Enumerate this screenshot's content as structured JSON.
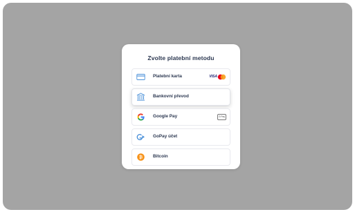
{
  "modal": {
    "title": "Zvolte platební metodu",
    "methods": [
      {
        "id": "card",
        "label": "Platební karta",
        "icon": "credit-card-icon",
        "badge_text": "VISA"
      },
      {
        "id": "bank",
        "label": "Bankovní převod",
        "icon": "bank-icon",
        "selected": true
      },
      {
        "id": "googlepay",
        "label": "Google Pay",
        "icon": "google-icon",
        "badge_text": "G Pay"
      },
      {
        "id": "gopay",
        "label": "GoPay účet",
        "icon": "gopay-icon"
      },
      {
        "id": "bitcoin",
        "label": "Bitcoin",
        "icon": "bitcoin-icon"
      }
    ]
  },
  "colors": {
    "overlay": "#a4a4a4",
    "modal_bg": "#ffffff",
    "text": "#2b3750",
    "accent_blue": "#4a90d9",
    "bitcoin_orange": "#f7931a"
  }
}
